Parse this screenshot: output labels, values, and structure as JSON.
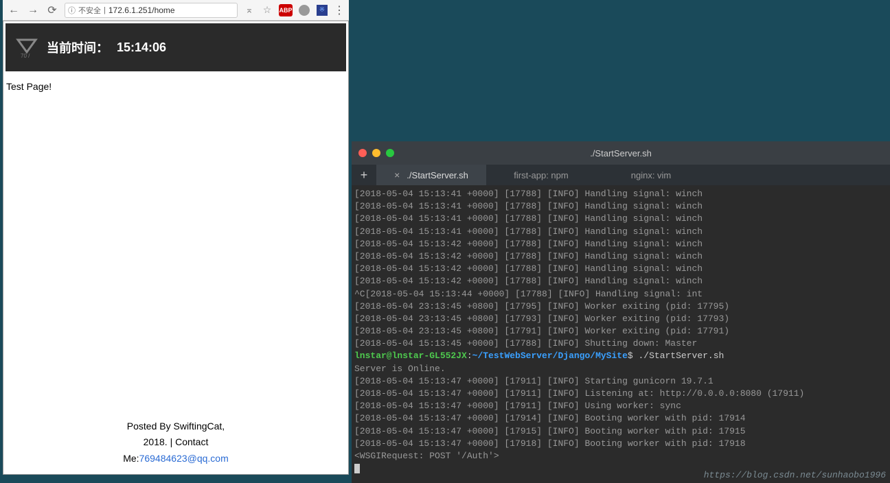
{
  "browser": {
    "url_insecure_label": "不安全",
    "url": "172.6.1.251/home",
    "nav_icons": {
      "back": "←",
      "forward": "→",
      "reload": "⟳"
    },
    "abp": "ABP"
  },
  "page": {
    "header_label": "当前时间：",
    "header_time": "15:14:06",
    "logo_sub": "70 /",
    "test_text": "Test Page!",
    "footer_line1": "Posted By SwiftingCat,",
    "footer_year": "2018.",
    "footer_sep": "|",
    "footer_contact": "Contact",
    "footer_me": "Me:",
    "footer_email": "769484623@qq.com"
  },
  "terminal": {
    "title": "./StartServer.sh",
    "tabs": [
      {
        "label": "./StartServer.sh",
        "active": true
      },
      {
        "label": "first-app: npm",
        "active": false
      },
      {
        "label": "nginx: vim",
        "active": false
      }
    ],
    "prompt_user": "lnstar@lnstar-GL552JX",
    "prompt_sep": ":",
    "prompt_path": "~/TestWebServer/Django/MySite",
    "prompt_dollar": "$",
    "prompt_cmd": "./StartServer.sh",
    "lines": [
      "[2018-05-04 15:13:41 +0000] [17788] [INFO] Handling signal: winch",
      "[2018-05-04 15:13:41 +0000] [17788] [INFO] Handling signal: winch",
      "[2018-05-04 15:13:41 +0000] [17788] [INFO] Handling signal: winch",
      "[2018-05-04 15:13:41 +0000] [17788] [INFO] Handling signal: winch",
      "[2018-05-04 15:13:42 +0000] [17788] [INFO] Handling signal: winch",
      "[2018-05-04 15:13:42 +0000] [17788] [INFO] Handling signal: winch",
      "[2018-05-04 15:13:42 +0000] [17788] [INFO] Handling signal: winch",
      "[2018-05-04 15:13:42 +0000] [17788] [INFO] Handling signal: winch",
      "^C[2018-05-04 15:13:44 +0000] [17788] [INFO] Handling signal: int",
      "[2018-05-04 23:13:45 +0800] [17795] [INFO] Worker exiting (pid: 17795)",
      "[2018-05-04 23:13:45 +0800] [17793] [INFO] Worker exiting (pid: 17793)",
      "[2018-05-04 23:13:45 +0800] [17791] [INFO] Worker exiting (pid: 17791)",
      "[2018-05-04 15:13:45 +0000] [17788] [INFO] Shutting down: Master"
    ],
    "lines2": [
      "Server is Online.",
      "[2018-05-04 15:13:47 +0000] [17911] [INFO] Starting gunicorn 19.7.1",
      "[2018-05-04 15:13:47 +0000] [17911] [INFO] Listening at: http://0.0.0.0:8080 (17911)",
      "[2018-05-04 15:13:47 +0000] [17911] [INFO] Using worker: sync",
      "[2018-05-04 15:13:47 +0000] [17914] [INFO] Booting worker with pid: 17914",
      "[2018-05-04 15:13:47 +0000] [17915] [INFO] Booting worker with pid: 17915",
      "[2018-05-04 15:13:47 +0000] [17918] [INFO] Booting worker with pid: 17918",
      "<WSGIRequest: POST '/Auth'>"
    ]
  },
  "watermark": "https://blog.csdn.net/sunhaobo1996"
}
